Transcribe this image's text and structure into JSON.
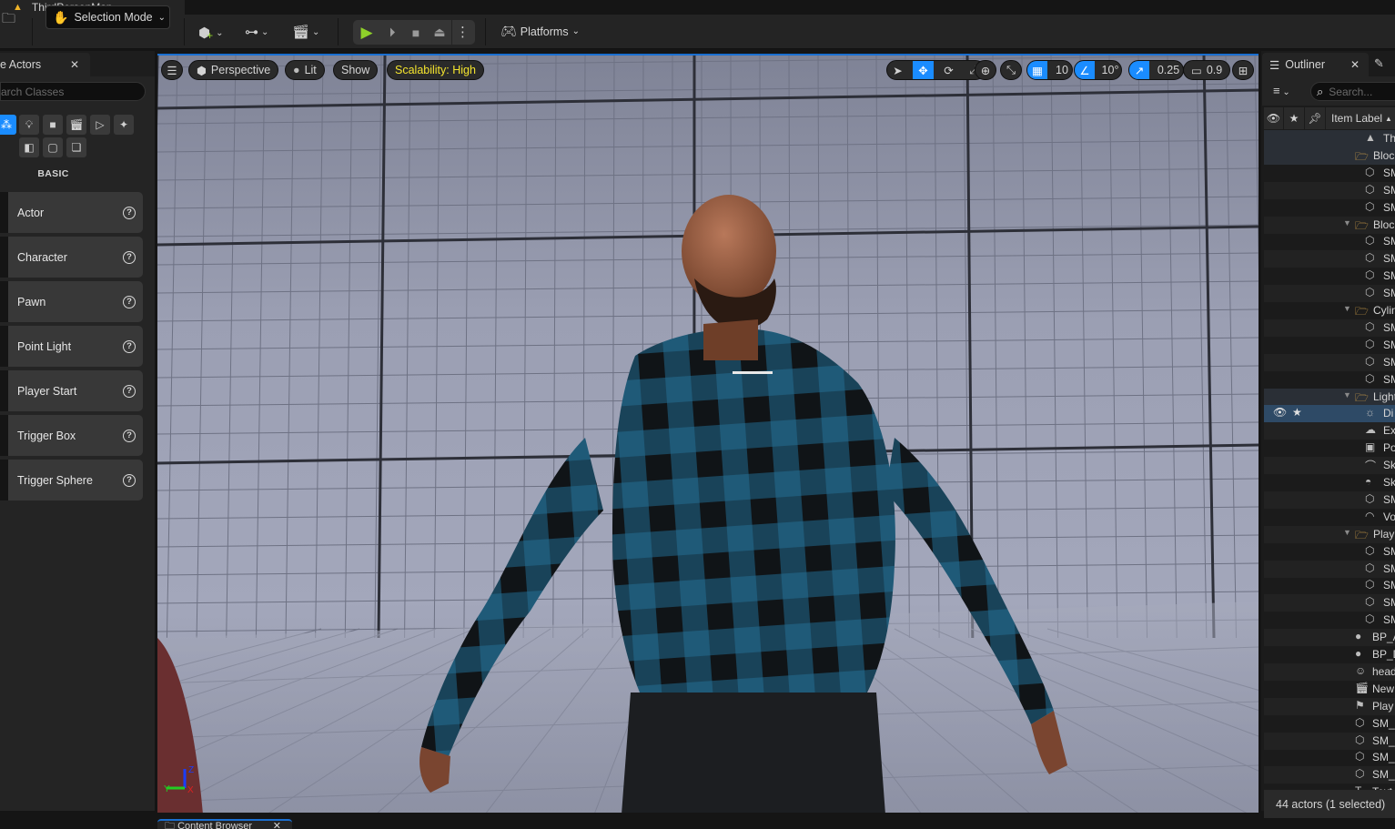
{
  "window": {
    "level_tab": "ThirdPersonMap",
    "warning_icon": "warning-icon"
  },
  "toolbar": {
    "content_icon": "content-browser-icon",
    "selection_mode": "Selection Mode",
    "add_icon": "add-actor-icon",
    "blueprint_icon": "blueprint-icon",
    "cinematics_icon": "cinematics-icon",
    "play_icon": "play-icon",
    "step_icon": "step-icon",
    "stop_icon": "stop-icon",
    "eject_icon": "eject-icon",
    "more_icon": "more-options-icon",
    "platforms": "Platforms",
    "accent_play": "#8fd12a"
  },
  "place_actors": {
    "tab_label": "Place Actors",
    "tab_visible_label": "e Actors",
    "search_placeholder": "Search Classes",
    "search_visible_placeholder": "arch Classes",
    "categories": [
      {
        "name": "recently-placed",
        "icon": "shapes-icon",
        "active": true
      },
      {
        "name": "lights",
        "icon": "lightbulb-icon"
      },
      {
        "name": "shapes",
        "icon": "cube-icon"
      },
      {
        "name": "cinematic",
        "icon": "clapper-icon"
      },
      {
        "name": "visual-effects",
        "icon": "media-icon"
      },
      {
        "name": "effects",
        "icon": "sparkle-icon"
      },
      {
        "name": "geometry",
        "icon": "geometry-icon"
      },
      {
        "name": "volumes",
        "icon": "volume-icon"
      },
      {
        "name": "all-classes",
        "icon": "stack-icon"
      }
    ],
    "section": "BASIC",
    "items": [
      "Actor",
      "Character",
      "Pawn",
      "Point Light",
      "Player Start",
      "Trigger Box",
      "Trigger Sphere"
    ]
  },
  "viewport": {
    "menu_icon": "hamburger-icon",
    "view_mode": "Perspective",
    "lighting": "Lit",
    "show": "Show",
    "scalability": "Scalability: High",
    "grid_snap": "10",
    "rotation_snap": "10°",
    "scale_snap": "0.25",
    "camera_speed": "0.9",
    "axis": {
      "x": "X",
      "y": "Y",
      "z": "Z"
    },
    "accent": "#1a8cff",
    "scalability_color": "#f5e52e"
  },
  "outliner": {
    "tab_label": "Outliner",
    "search_placeholder": "Search...",
    "header_label": "Item Label",
    "rows": [
      {
        "indent": 3,
        "type": "level",
        "name": "ThirdPersonMap",
        "shown": "ThirdP",
        "hl": true
      },
      {
        "indent": 2,
        "type": "folder",
        "name": "Bloc",
        "hl": true,
        "collapsed": true
      },
      {
        "indent": 3,
        "type": "mesh",
        "name": "SM"
      },
      {
        "indent": 3,
        "type": "mesh",
        "name": "SM"
      },
      {
        "indent": 3,
        "type": "mesh",
        "name": "SM"
      },
      {
        "indent": 2,
        "type": "folder",
        "name": "Bloc",
        "expanded": true
      },
      {
        "indent": 3,
        "type": "mesh",
        "name": "SM"
      },
      {
        "indent": 3,
        "type": "mesh",
        "name": "SM"
      },
      {
        "indent": 3,
        "type": "mesh",
        "name": "SM"
      },
      {
        "indent": 3,
        "type": "mesh",
        "name": "SM"
      },
      {
        "indent": 2,
        "type": "folder",
        "name": "Cylin",
        "expanded": true
      },
      {
        "indent": 3,
        "type": "mesh",
        "name": "SM"
      },
      {
        "indent": 3,
        "type": "mesh",
        "name": "SM"
      },
      {
        "indent": 3,
        "type": "mesh",
        "name": "SM"
      },
      {
        "indent": 3,
        "type": "mesh",
        "name": "SM"
      },
      {
        "indent": 2,
        "type": "folder",
        "name": "Light",
        "expanded": true,
        "hl": true
      },
      {
        "indent": 3,
        "type": "directional-light",
        "name": "Di",
        "selected": true
      },
      {
        "indent": 3,
        "type": "fog",
        "name": "Ex"
      },
      {
        "indent": 3,
        "type": "post-process",
        "name": "Po"
      },
      {
        "indent": 3,
        "type": "sky-atmosphere",
        "name": "Sk"
      },
      {
        "indent": 3,
        "type": "sky-light",
        "name": "Sk"
      },
      {
        "indent": 3,
        "type": "mesh",
        "name": "SM"
      },
      {
        "indent": 3,
        "type": "cloud",
        "name": "Vo"
      },
      {
        "indent": 2,
        "type": "folder",
        "name": "Play",
        "expanded": true
      },
      {
        "indent": 3,
        "type": "mesh",
        "name": "SM"
      },
      {
        "indent": 3,
        "type": "mesh",
        "name": "SM"
      },
      {
        "indent": 3,
        "type": "mesh",
        "name": "SM"
      },
      {
        "indent": 3,
        "type": "mesh",
        "name": "SM"
      },
      {
        "indent": 3,
        "type": "mesh",
        "name": "SM"
      },
      {
        "indent": 1,
        "type": "blueprint",
        "name": "BP_A"
      },
      {
        "indent": 1,
        "type": "blueprint",
        "name": "BP_D"
      },
      {
        "indent": 1,
        "type": "skeletal",
        "name": "head"
      },
      {
        "indent": 1,
        "type": "sequence",
        "name": "New"
      },
      {
        "indent": 1,
        "type": "player-start",
        "name": "Play"
      },
      {
        "indent": 1,
        "type": "mesh",
        "name": "SM_"
      },
      {
        "indent": 1,
        "type": "mesh",
        "name": "SM_"
      },
      {
        "indent": 1,
        "type": "mesh",
        "name": "SM_"
      },
      {
        "indent": 1,
        "type": "mesh",
        "name": "SM_"
      },
      {
        "indent": 1,
        "type": "text",
        "name": "Text"
      }
    ],
    "status": "44 actors (1 selected)"
  },
  "bottom": {
    "content_browser": "Content Browser"
  }
}
